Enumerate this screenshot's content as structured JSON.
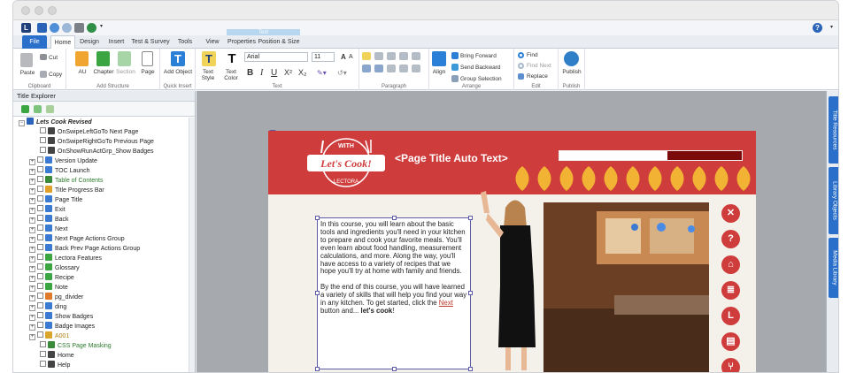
{
  "quick_access": {
    "icons": [
      "lectora-icon",
      "save-icon",
      "undo-icon",
      "redo-icon",
      "print-icon",
      "globe-icon"
    ]
  },
  "context_tab_header": "Text",
  "tabs": [
    "File",
    "Home",
    "Design",
    "Insert",
    "Test & Survey",
    "Tools",
    "View",
    "Properties",
    "Position & Size"
  ],
  "ribbon": {
    "clipboard": {
      "paste": "Paste",
      "cut": "Cut",
      "copy": "Copy",
      "label": "Clipboard"
    },
    "add_structure": {
      "au": "AU",
      "chapter": "Chapter",
      "section": "Section",
      "page": "Page",
      "label": "Add Structure"
    },
    "quick_insert": {
      "add_object": "Add Object",
      "label": "Quick Insert"
    },
    "text": {
      "text_style": "Text Style",
      "text_color": "Text Color",
      "font": "Arial",
      "size": "11",
      "label": "Text"
    },
    "paragraph": {
      "label": "Paragraph"
    },
    "arrange": {
      "align": "Align",
      "bring_forward": "Bring Forward",
      "send_backward": "Send Backward",
      "group_selection": "Group Selection",
      "label": "Arrange"
    },
    "edit": {
      "find": "Find",
      "find_next": "Find Next",
      "replace": "Replace",
      "label": "Edit"
    },
    "publish": {
      "publish": "Publish",
      "label": "Publish"
    }
  },
  "explorer": {
    "title": "Title Explorer",
    "items": [
      {
        "label": "Lets Cook Revised",
        "level": 0
      },
      {
        "label": "OnSwipeLeftGoTo Next Page",
        "level": 2
      },
      {
        "label": "OnSwipeRightGoTo Previous Page",
        "level": 2
      },
      {
        "label": "OnShowRunActGrp_Show Badges",
        "level": 2
      },
      {
        "label": "Version Update",
        "level": 1
      },
      {
        "label": "TOC Launch",
        "level": 1
      },
      {
        "label": "Table of Contents",
        "level": 1
      },
      {
        "label": "Title Progress Bar",
        "level": 1
      },
      {
        "label": "Page Title",
        "level": 1
      },
      {
        "label": "Exit",
        "level": 1
      },
      {
        "label": "Back",
        "level": 1
      },
      {
        "label": "Next",
        "level": 1
      },
      {
        "label": "Next Page Actions Group",
        "level": 1
      },
      {
        "label": "Back Prev Page Actions Group",
        "level": 1
      },
      {
        "label": "Lectora Features",
        "level": 1
      },
      {
        "label": "Glossary",
        "level": 1
      },
      {
        "label": "Recipe",
        "level": 1
      },
      {
        "label": "Note",
        "level": 1
      },
      {
        "label": "pg_divider",
        "level": 1
      },
      {
        "label": "ding",
        "level": 1
      },
      {
        "label": "Show Badges",
        "level": 1
      },
      {
        "label": "Badge Images",
        "level": 1
      },
      {
        "label": "A001",
        "level": 1
      },
      {
        "label": "CSS Page Masking",
        "level": 2
      },
      {
        "label": "Home",
        "level": 2
      },
      {
        "label": "Help",
        "level": 2
      }
    ]
  },
  "page": {
    "logo_top": "WITH",
    "logo_main": "Let's Cook!",
    "logo_bottom": "LECTORA",
    "title": "<Page Title Auto Text>",
    "progress": 0.59,
    "body_p1": "In this course, you will learn about the basic tools and ingredients you'll need in your kitchen to prepare and cook your favorite meals. You'll even learn about food handling, measurement calculations, and more. Along the way, you'll have access to a variety of recipes that we hope you'll try at home with family and friends.",
    "body_p2_a": "By the end of this course, you will have learned a variety of skills that will help you find your way in any kitchen. To get started, click the ",
    "body_p2_link": "Next",
    "body_p2_b": " button and... ",
    "body_p2_bold": "let's cook",
    "body_p2_end": "!",
    "nav_buttons": [
      "close-icon",
      "help-icon",
      "home-icon",
      "notes-icon",
      "lectora-l-icon",
      "book-icon",
      "utensils-icon"
    ]
  },
  "side_tabs": [
    "Title Resources",
    "Library Objects",
    "Media Library"
  ],
  "colors": {
    "brand_red": "#cf3c3c",
    "accent_blue": "#2a6fc9",
    "leaf_gold": "#f2b233"
  }
}
